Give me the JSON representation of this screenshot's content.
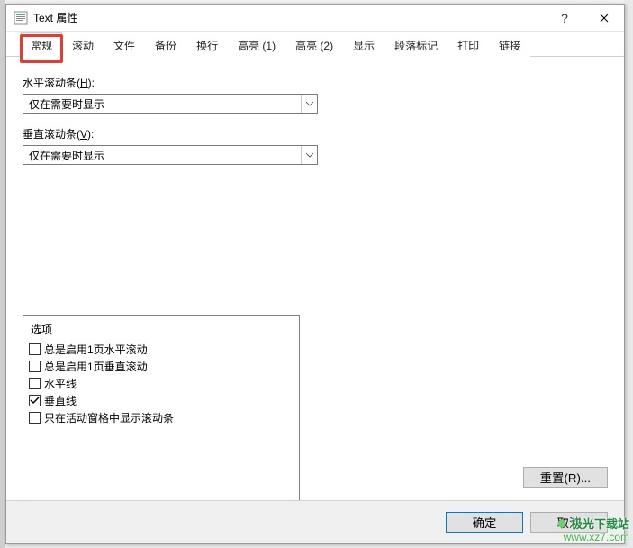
{
  "window": {
    "title": "Text 属性",
    "help": "?",
    "close": "×"
  },
  "tabs": [
    "常规",
    "滚动",
    "文件",
    "备份",
    "换行",
    "高亮 (1)",
    "高亮 (2)",
    "显示",
    "段落标记",
    "打印",
    "链接"
  ],
  "active_tab_index": 0,
  "fields": {
    "hscroll": {
      "label_prefix": "水平滚动条(",
      "label_key": "H",
      "label_suffix": "):",
      "value": "仅在需要时显示"
    },
    "vscroll": {
      "label_prefix": "垂直滚动条(",
      "label_key": "V",
      "label_suffix": "):",
      "value": "仅在需要时显示"
    }
  },
  "options": {
    "header": "选项",
    "items": [
      {
        "label": "总是启用1页水平滚动",
        "checked": false
      },
      {
        "label": "总是启用1页垂直滚动",
        "checked": false
      },
      {
        "label": "水平线",
        "checked": false
      },
      {
        "label": "垂直线",
        "checked": true
      },
      {
        "label": "只在活动窗格中显示滚动条",
        "checked": false
      }
    ]
  },
  "buttons": {
    "reset": "重置(R)...",
    "ok": "确定",
    "cancel": "取消"
  },
  "watermark": {
    "line1": "极光下载站",
    "line2": "www.xz7.com"
  }
}
